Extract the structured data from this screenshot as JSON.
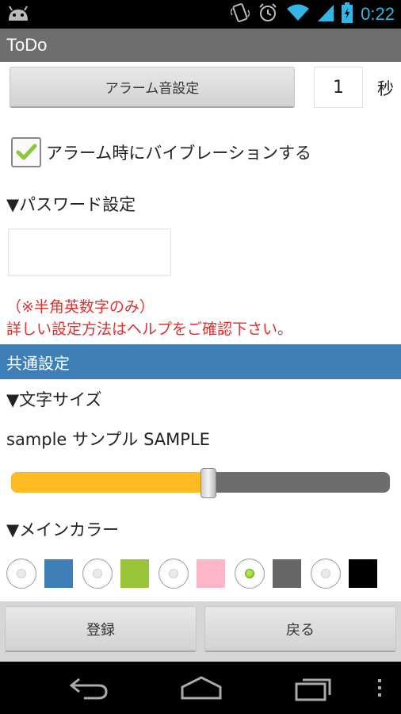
{
  "status_bar": {
    "time": "0:22",
    "icons": [
      "android-icon",
      "vibrate-icon",
      "alarm-icon",
      "wifi-icon",
      "signal-icon",
      "battery-icon"
    ]
  },
  "app": {
    "title": "ToDo"
  },
  "alarm": {
    "sound_button_label": "アラーム音設定",
    "seconds_value": "1",
    "seconds_unit": "秒",
    "vibrate_label": "アラーム時にバイブレーションする",
    "vibrate_checked": true
  },
  "password": {
    "heading": "▼パスワード設定",
    "value": "",
    "note_line1": "（※半角英数字のみ）",
    "note_line2": "詳しい設定方法はヘルプをご確認下さい。"
  },
  "common": {
    "section_title": "共通設定",
    "font_size_heading": "▼文字サイズ",
    "sample_text": "sample サンプル SAMPLE",
    "font_size_level": 0.52,
    "main_color_heading": "▼メインカラー",
    "colors": [
      {
        "hex": "#3f7fb8",
        "selected": false
      },
      {
        "hex": "#9ac43a",
        "selected": false
      },
      {
        "hex": "#ffb6c8",
        "selected": false
      },
      {
        "hex": "#666666",
        "selected": true
      },
      {
        "hex": "#000000",
        "selected": false
      }
    ]
  },
  "actions": {
    "register_label": "登録",
    "back_label": "戻る"
  },
  "nav": {
    "icons": [
      "back-icon",
      "home-icon",
      "recent-apps-icon",
      "menu-icon"
    ]
  },
  "theme": {
    "accent": "#33b5e5",
    "title_bar": "#6e6e6e",
    "section_bar": "#3f7fb8",
    "slider_fill": "#ffbb22",
    "note_red": "#e03030"
  }
}
